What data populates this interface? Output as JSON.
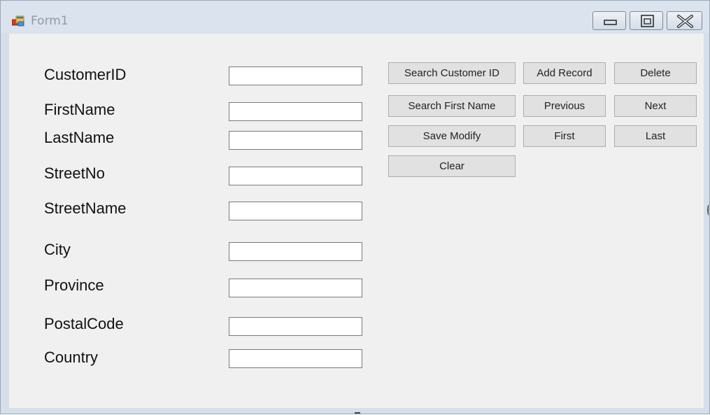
{
  "window": {
    "title": "Form1",
    "controls": {
      "minimize_icon": "minimize-icon",
      "maximize_icon": "restore-icon",
      "close_icon": "close-icon"
    }
  },
  "form": {
    "fields": [
      {
        "label": "CustomerID",
        "value": "",
        "placeholder": ""
      },
      {
        "label": "FirstName",
        "value": "",
        "placeholder": ""
      },
      {
        "label": "LastName",
        "value": "",
        "placeholder": ""
      },
      {
        "label": "StreetNo",
        "value": "",
        "placeholder": ""
      },
      {
        "label": "StreetName",
        "value": "",
        "placeholder": ""
      },
      {
        "label": "City",
        "value": "",
        "placeholder": ""
      },
      {
        "label": "Province",
        "value": "",
        "placeholder": ""
      },
      {
        "label": "PostalCode",
        "value": "",
        "placeholder": ""
      },
      {
        "label": "Country",
        "value": "",
        "placeholder": ""
      }
    ],
    "buttons": {
      "search_customer_id": "Search Customer ID",
      "add_record": "Add Record",
      "delete": "Delete",
      "search_first_name": "Search First Name",
      "previous": "Previous",
      "next": "Next",
      "save_modify": "Save Modify",
      "first": "First",
      "last": "Last",
      "clear": "Clear"
    }
  },
  "colors": {
    "titlebar": "#dbe4ee",
    "client_background": "#f0f0f0",
    "button_face": "#e1e1e1",
    "button_border": "#adadad"
  }
}
